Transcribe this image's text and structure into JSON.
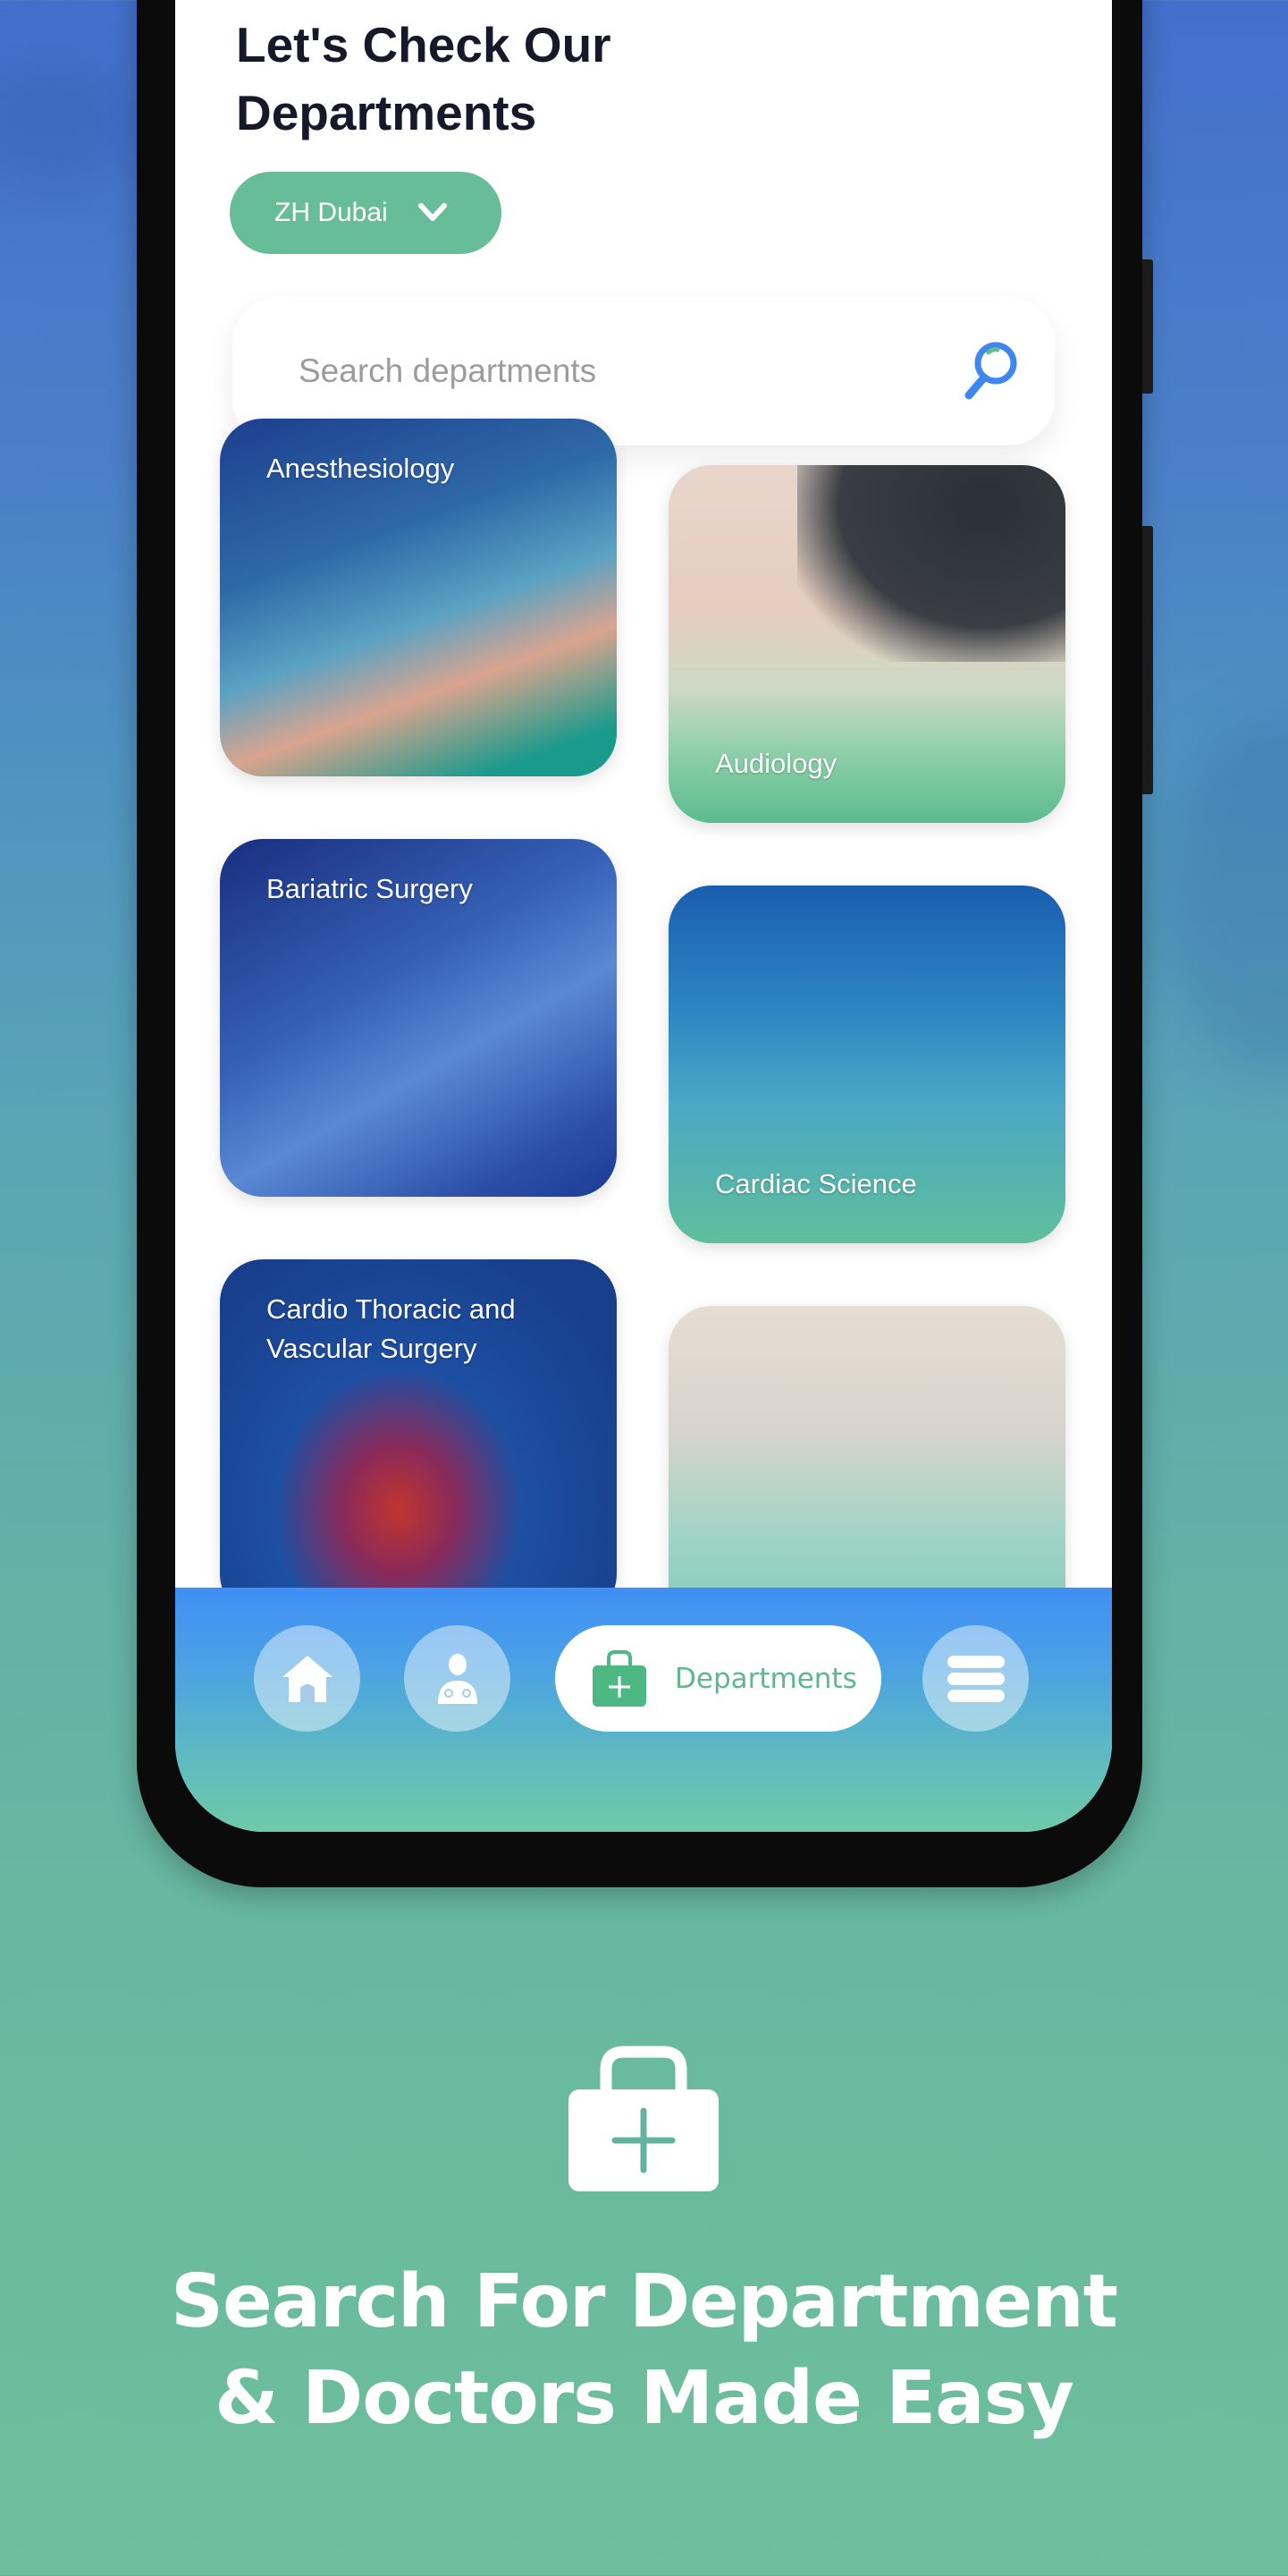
{
  "app": {
    "title_line1": "Let's Check Our",
    "title_line2": "Departments",
    "location": {
      "selected": "ZH Dubai",
      "icon": "chevron-down-icon"
    },
    "search": {
      "placeholder": "Search departments",
      "value": "",
      "icon": "search-icon"
    },
    "departments": [
      {
        "name": "Anesthesiology",
        "label_position": "top"
      },
      {
        "name": "Audiology",
        "label_position": "bottom"
      },
      {
        "name": "Bariatric Surgery",
        "label_position": "top"
      },
      {
        "name": "Cardiac Science",
        "label_position": "bottom"
      },
      {
        "name": "Cardio Thoracic and Vascular Surgery",
        "label_position": "top"
      },
      {
        "name": "",
        "label_position": "none"
      }
    ],
    "bottom_nav": {
      "items": [
        {
          "id": "home",
          "icon": "home-icon",
          "label": ""
        },
        {
          "id": "doctors",
          "icon": "doctor-icon",
          "label": ""
        },
        {
          "id": "departments",
          "icon": "medical-bag-icon",
          "label": "Departments",
          "active": true
        },
        {
          "id": "menu",
          "icon": "menu-icon",
          "label": ""
        }
      ]
    }
  },
  "promo": {
    "icon": "medical-bag-icon",
    "headline_line1": "Search For Department",
    "headline_line2": "& Doctors Made Easy"
  },
  "colors": {
    "brand_green": "#67bd98",
    "brand_blue": "#3f8ff5",
    "title_text": "#17182a",
    "nav_label": "#5fb790"
  }
}
